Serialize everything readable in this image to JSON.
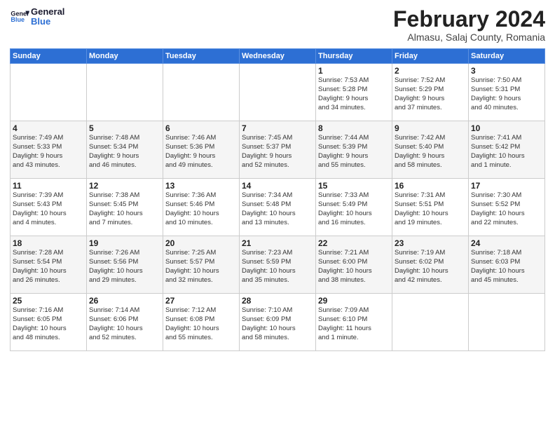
{
  "header": {
    "logo_general": "General",
    "logo_blue": "Blue",
    "month_title": "February 2024",
    "location": "Almasu, Salaj County, Romania"
  },
  "calendar": {
    "days_of_week": [
      "Sunday",
      "Monday",
      "Tuesday",
      "Wednesday",
      "Thursday",
      "Friday",
      "Saturday"
    ],
    "weeks": [
      [
        {
          "day": "",
          "info": ""
        },
        {
          "day": "",
          "info": ""
        },
        {
          "day": "",
          "info": ""
        },
        {
          "day": "",
          "info": ""
        },
        {
          "day": "1",
          "info": "Sunrise: 7:53 AM\nSunset: 5:28 PM\nDaylight: 9 hours\nand 34 minutes."
        },
        {
          "day": "2",
          "info": "Sunrise: 7:52 AM\nSunset: 5:29 PM\nDaylight: 9 hours\nand 37 minutes."
        },
        {
          "day": "3",
          "info": "Sunrise: 7:50 AM\nSunset: 5:31 PM\nDaylight: 9 hours\nand 40 minutes."
        }
      ],
      [
        {
          "day": "4",
          "info": "Sunrise: 7:49 AM\nSunset: 5:33 PM\nDaylight: 9 hours\nand 43 minutes."
        },
        {
          "day": "5",
          "info": "Sunrise: 7:48 AM\nSunset: 5:34 PM\nDaylight: 9 hours\nand 46 minutes."
        },
        {
          "day": "6",
          "info": "Sunrise: 7:46 AM\nSunset: 5:36 PM\nDaylight: 9 hours\nand 49 minutes."
        },
        {
          "day": "7",
          "info": "Sunrise: 7:45 AM\nSunset: 5:37 PM\nDaylight: 9 hours\nand 52 minutes."
        },
        {
          "day": "8",
          "info": "Sunrise: 7:44 AM\nSunset: 5:39 PM\nDaylight: 9 hours\nand 55 minutes."
        },
        {
          "day": "9",
          "info": "Sunrise: 7:42 AM\nSunset: 5:40 PM\nDaylight: 9 hours\nand 58 minutes."
        },
        {
          "day": "10",
          "info": "Sunrise: 7:41 AM\nSunset: 5:42 PM\nDaylight: 10 hours\nand 1 minute."
        }
      ],
      [
        {
          "day": "11",
          "info": "Sunrise: 7:39 AM\nSunset: 5:43 PM\nDaylight: 10 hours\nand 4 minutes."
        },
        {
          "day": "12",
          "info": "Sunrise: 7:38 AM\nSunset: 5:45 PM\nDaylight: 10 hours\nand 7 minutes."
        },
        {
          "day": "13",
          "info": "Sunrise: 7:36 AM\nSunset: 5:46 PM\nDaylight: 10 hours\nand 10 minutes."
        },
        {
          "day": "14",
          "info": "Sunrise: 7:34 AM\nSunset: 5:48 PM\nDaylight: 10 hours\nand 13 minutes."
        },
        {
          "day": "15",
          "info": "Sunrise: 7:33 AM\nSunset: 5:49 PM\nDaylight: 10 hours\nand 16 minutes."
        },
        {
          "day": "16",
          "info": "Sunrise: 7:31 AM\nSunset: 5:51 PM\nDaylight: 10 hours\nand 19 minutes."
        },
        {
          "day": "17",
          "info": "Sunrise: 7:30 AM\nSunset: 5:52 PM\nDaylight: 10 hours\nand 22 minutes."
        }
      ],
      [
        {
          "day": "18",
          "info": "Sunrise: 7:28 AM\nSunset: 5:54 PM\nDaylight: 10 hours\nand 26 minutes."
        },
        {
          "day": "19",
          "info": "Sunrise: 7:26 AM\nSunset: 5:56 PM\nDaylight: 10 hours\nand 29 minutes."
        },
        {
          "day": "20",
          "info": "Sunrise: 7:25 AM\nSunset: 5:57 PM\nDaylight: 10 hours\nand 32 minutes."
        },
        {
          "day": "21",
          "info": "Sunrise: 7:23 AM\nSunset: 5:59 PM\nDaylight: 10 hours\nand 35 minutes."
        },
        {
          "day": "22",
          "info": "Sunrise: 7:21 AM\nSunset: 6:00 PM\nDaylight: 10 hours\nand 38 minutes."
        },
        {
          "day": "23",
          "info": "Sunrise: 7:19 AM\nSunset: 6:02 PM\nDaylight: 10 hours\nand 42 minutes."
        },
        {
          "day": "24",
          "info": "Sunrise: 7:18 AM\nSunset: 6:03 PM\nDaylight: 10 hours\nand 45 minutes."
        }
      ],
      [
        {
          "day": "25",
          "info": "Sunrise: 7:16 AM\nSunset: 6:05 PM\nDaylight: 10 hours\nand 48 minutes."
        },
        {
          "day": "26",
          "info": "Sunrise: 7:14 AM\nSunset: 6:06 PM\nDaylight: 10 hours\nand 52 minutes."
        },
        {
          "day": "27",
          "info": "Sunrise: 7:12 AM\nSunset: 6:08 PM\nDaylight: 10 hours\nand 55 minutes."
        },
        {
          "day": "28",
          "info": "Sunrise: 7:10 AM\nSunset: 6:09 PM\nDaylight: 10 hours\nand 58 minutes."
        },
        {
          "day": "29",
          "info": "Sunrise: 7:09 AM\nSunset: 6:10 PM\nDaylight: 11 hours\nand 1 minute."
        },
        {
          "day": "",
          "info": ""
        },
        {
          "day": "",
          "info": ""
        }
      ]
    ]
  }
}
